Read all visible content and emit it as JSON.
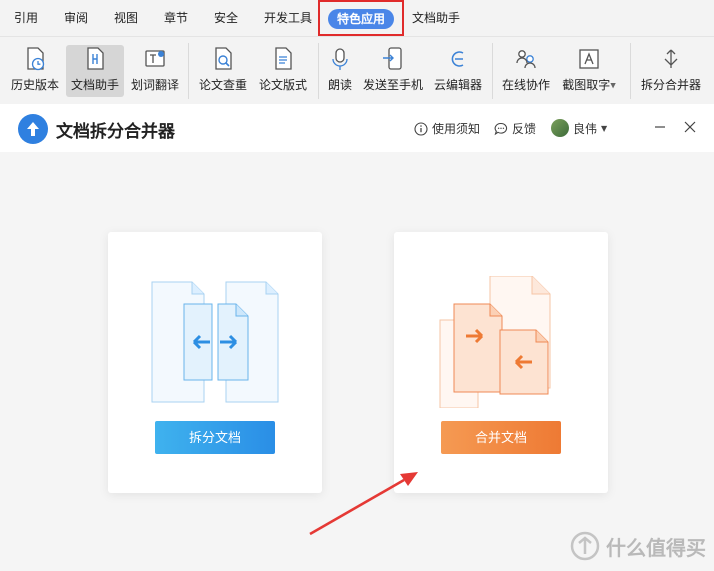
{
  "menubar": {
    "tabs": [
      "引用",
      "审阅",
      "视图",
      "章节",
      "安全",
      "开发工具",
      "特色应用",
      "文档助手"
    ]
  },
  "ribbon": {
    "buttons": [
      "历史版本",
      "文档助手",
      "划词翻译",
      "论文查重",
      "论文版式",
      "朗读",
      "发送至手机",
      "云编辑器",
      "在线协作",
      "截图取字",
      "拆分合并器"
    ]
  },
  "app": {
    "title": "文档拆分合并器",
    "help_label": "使用须知",
    "feedback_label": "反馈",
    "user_name": "良伟"
  },
  "cards": {
    "split_label": "拆分文档",
    "merge_label": "合并文档"
  },
  "watermark": {
    "text": "什么值得买"
  },
  "colors": {
    "accent_blue": "#4a86e8",
    "highlight_red": "#e02b2b",
    "split_button": "#2a8ee6",
    "merge_button": "#ee7a34",
    "annotation_arrow": "#e53935"
  }
}
